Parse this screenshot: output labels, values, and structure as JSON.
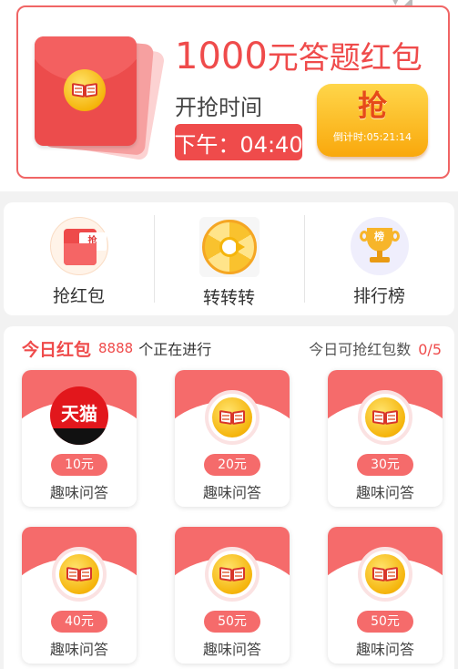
{
  "top": {
    "title_amount": "1000",
    "title_suffix": "元答题红包",
    "open_label": "开抢时间",
    "open_time": "下午：04:40",
    "grab_button": "抢",
    "countdown": "倒计时:05:21:14"
  },
  "menu": [
    {
      "label": "抢红包",
      "icon_text": "抢",
      "icon": "red-envelope-icon"
    },
    {
      "label": "转转转",
      "icon": "spin-wheel-icon"
    },
    {
      "label": "排行榜",
      "icon_text": "榜",
      "icon": "trophy-icon"
    }
  ],
  "today": {
    "title": "今日红包",
    "count": "8888",
    "desc": "个正在进行",
    "quota_label": "今日可抢红包数",
    "quota_value": "0/5"
  },
  "tiles": [
    {
      "amount": "10元",
      "label": "趣味问答",
      "logo": "天猫",
      "icon": "tmall-logo-icon"
    },
    {
      "amount": "20元",
      "label": "趣味问答",
      "icon": "book-coin-icon"
    },
    {
      "amount": "30元",
      "label": "趣味问答",
      "icon": "book-coin-icon"
    },
    {
      "amount": "40元",
      "label": "趣味问答",
      "icon": "book-coin-icon"
    },
    {
      "amount": "50元",
      "label": "趣味问答",
      "icon": "book-coin-icon"
    },
    {
      "amount": "50元",
      "label": "趣味问答",
      "icon": "book-coin-icon"
    }
  ],
  "colors": {
    "primary_red": "#ef4b4b",
    "tile_red": "#f56b6b",
    "gold": "#f9a80c"
  }
}
